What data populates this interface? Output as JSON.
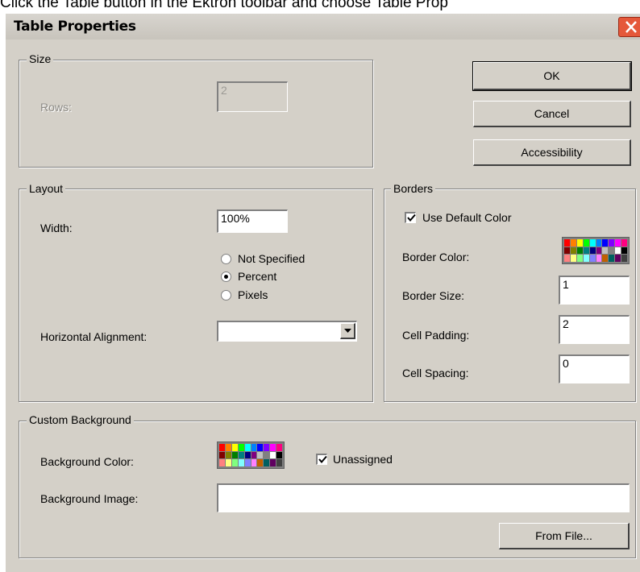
{
  "caption": "Click the Table button in the Ektron toolbar and choose Table Prop",
  "window": {
    "title": "Table Properties"
  },
  "size": {
    "legend": "Size",
    "rows_label": "Rows:",
    "rows_value": "2"
  },
  "buttons": {
    "ok": "OK",
    "cancel": "Cancel",
    "accessibility": "Accessibility"
  },
  "layout": {
    "legend": "Layout",
    "width_label": "Width:",
    "width_value": "100%",
    "radios": [
      {
        "label": "Not Specified",
        "checked": false
      },
      {
        "label": "Percent",
        "checked": true
      },
      {
        "label": "Pixels",
        "checked": false
      }
    ],
    "halign_label": "Horizontal Alignment:",
    "halign_value": ""
  },
  "borders": {
    "legend": "Borders",
    "use_default_label": "Use Default Color",
    "use_default_checked": true,
    "color_label": "Border Color:",
    "size_label": "Border Size:",
    "size_value": "1",
    "padding_label": "Cell Padding:",
    "padding_value": "2",
    "spacing_label": "Cell Spacing:",
    "spacing_value": "0"
  },
  "background": {
    "legend": "Custom Background",
    "color_label": "Background Color:",
    "unassigned_label": "Unassigned",
    "unassigned_checked": true,
    "image_label": "Background Image:",
    "image_value": "",
    "from_file_label": "From File..."
  },
  "colors": {
    "dialog": "#d4d0c8",
    "close_button": "#e5583a"
  }
}
